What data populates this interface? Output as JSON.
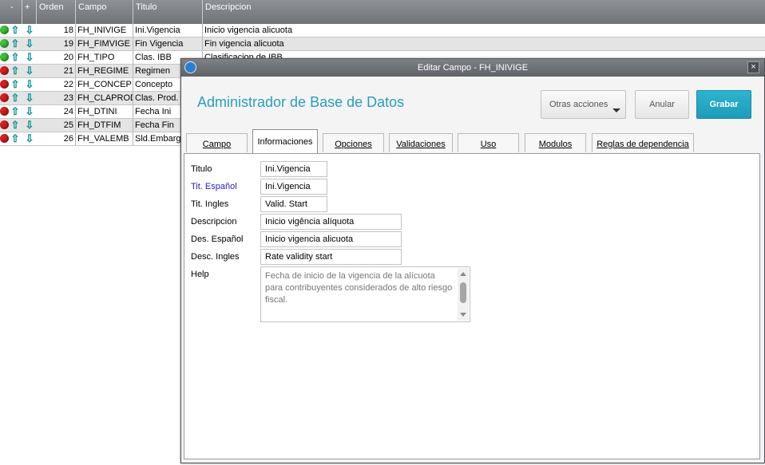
{
  "grid": {
    "headers": {
      "minus": "-",
      "plus": "+",
      "orden": "Orden",
      "campo": "Campo",
      "titulo": "Titulo",
      "descripcion": "Descripcion"
    },
    "rows": [
      {
        "status": "green",
        "orden": "18",
        "campo": "FH_INIVIGE",
        "titulo": "Ini.Vigencia",
        "descripcion": "Inicio vigencia alicuota"
      },
      {
        "status": "green",
        "orden": "19",
        "campo": "FH_FIMVIGE",
        "titulo": "Fin Vigencia",
        "descripcion": "Fin vigencia alicuota"
      },
      {
        "status": "green",
        "orden": "20",
        "campo": "FH_TIPO",
        "titulo": "Clas. IBB",
        "descripcion": "Clasificacion de IBB"
      },
      {
        "status": "red",
        "orden": "21",
        "campo": "FH_REGIME",
        "titulo": "Regimen",
        "descripcion": ""
      },
      {
        "status": "red",
        "orden": "22",
        "campo": "FH_CONCEP",
        "titulo": "Concepto",
        "descripcion": ""
      },
      {
        "status": "red",
        "orden": "23",
        "campo": "FH_CLAPROD",
        "titulo": "Clas. Prod.",
        "descripcion": ""
      },
      {
        "status": "red",
        "orden": "24",
        "campo": "FH_DTINI",
        "titulo": "Fecha Ini",
        "descripcion": ""
      },
      {
        "status": "red",
        "orden": "25",
        "campo": "FH_DTFIM",
        "titulo": "Fecha Fin",
        "descripcion": ""
      },
      {
        "status": "red",
        "orden": "26",
        "campo": "FH_VALEMB",
        "titulo": "Sld.Embarge",
        "descripcion": ""
      }
    ],
    "arrow_up_glyph": "⇧",
    "arrow_down_glyph": "⇩"
  },
  "dialog": {
    "title": "Editar Campo - FH_INIVIGE",
    "close_glyph": "×",
    "heading": "Administrador de Base de Datos",
    "buttons": {
      "otras": "Otras acciones",
      "anular": "Anular",
      "grabar": "Grabar"
    },
    "tabs": [
      {
        "label": "Campo",
        "active": false
      },
      {
        "label": "Informaciones",
        "active": true
      },
      {
        "label": "Opciones",
        "active": false
      },
      {
        "label": "Validaciones",
        "active": false
      },
      {
        "label": "Uso",
        "active": false
      },
      {
        "label": "Modulos",
        "active": false
      },
      {
        "label": "Reglas de dependencia",
        "active": false
      }
    ],
    "form": {
      "titulo_label": "Titulo",
      "titulo_value": "Ini.Vigencia",
      "tit_esp_label": "Tit. Español",
      "tit_esp_value": "Ini.Vigencia",
      "tit_ing_label": "Tit. Ingles",
      "tit_ing_value": "Valid. Start",
      "desc_label": "Descripcion",
      "desc_value": "Inicio vigência alíquota",
      "des_esp_label": "Des. Español",
      "des_esp_value": "Inicio vigencia alicuota",
      "desc_ing_label": "Desc. Ingles",
      "desc_ing_value": "Rate validity start",
      "help_label": "Help",
      "help_value": "Fecha de inicio de la vigencia de la alícuota para contribuyentes considerados de alto riesgo fiscal."
    }
  },
  "colors": {
    "accent": "#2a9fb9",
    "grabar": "#1e9cb9",
    "status_green": "#3cc23c",
    "status_red": "#d61f1f",
    "label_blue": "#1e1ec8"
  }
}
